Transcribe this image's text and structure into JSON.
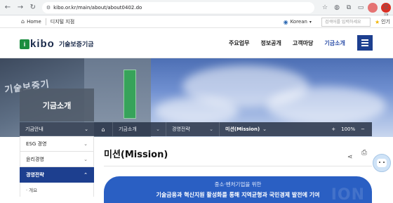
{
  "browser": {
    "url": "kibo.or.kr/main/about/about0402.do",
    "back_icon": "arrow-left-icon",
    "forward_icon": "arrow-right-icon",
    "reload_icon": "reload-icon",
    "profile_label": "오류"
  },
  "utility": {
    "home_label": "Home",
    "branch_label": "디지털 지점",
    "language": "Korean",
    "search_placeholder": "검색어를 입력하세요",
    "popular_label": "인기"
  },
  "header": {
    "logo_mark": "i",
    "logo_word": "kibo",
    "logo_korean": "기술보증기금",
    "menu": [
      "주요업무",
      "정보공개",
      "고객마당",
      "기금소개"
    ],
    "active_menu": "기금소개"
  },
  "hero": {
    "section_title": "기금소개",
    "building_sign": "기술보증기"
  },
  "breadcrumb": {
    "items": [
      "기금소개",
      "경영전략",
      "미션(Mission)"
    ],
    "zoom_minus": "−",
    "zoom_plus": "+",
    "zoom_level": "100%"
  },
  "sidebar": {
    "items": [
      {
        "label": "기금안내"
      },
      {
        "label": "ESG 경영"
      },
      {
        "label": "윤리경영"
      },
      {
        "label": "경영전략"
      }
    ],
    "sub_items": [
      {
        "label": "· 개요"
      }
    ],
    "active_index": 3
  },
  "content": {
    "page_title": "미션(Mission)",
    "mission_line1": "중소·벤처기업을 위한",
    "mission_line2": "기술금융과 혁신지원 활성화를 통해 지역균형과 국민경제 발전에 기여",
    "mission_ghost": "ION"
  },
  "colors": {
    "primary": "#1d3f8f",
    "banner": "#2a5fc3",
    "logo_green": "#1b8d3f"
  }
}
